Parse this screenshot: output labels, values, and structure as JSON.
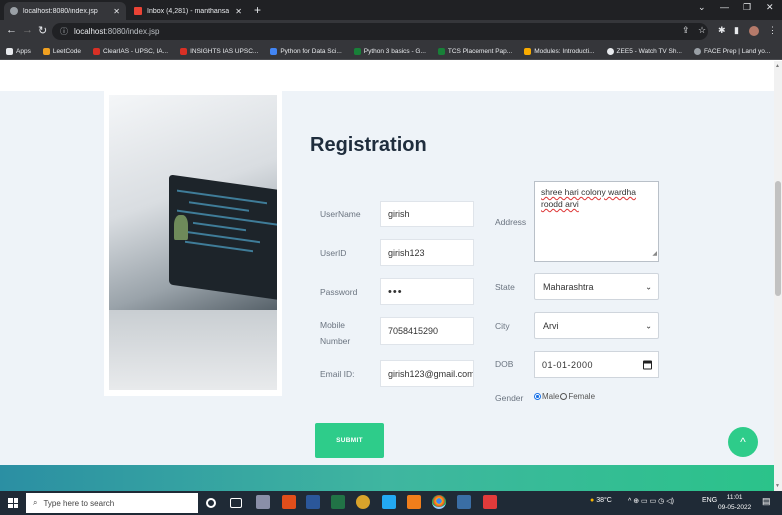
{
  "browser": {
    "tabs": [
      {
        "title": "localhost:8080/index.jsp",
        "favicon": "globe-icon",
        "active": true
      },
      {
        "title": "Inbox (4,281) - manthansapkal1...",
        "favicon": "gmail-icon",
        "active": false
      }
    ],
    "new_tab": "+",
    "address": {
      "host": "localhost",
      "rest": ":8080/index.jsp"
    },
    "bookmarks": [
      {
        "label": "Apps",
        "color": "#e8eaed"
      },
      {
        "label": "LeetCode",
        "color": "#f0a020"
      },
      {
        "label": "ClearIAS - UPSC, IA...",
        "color": "#d93025"
      },
      {
        "label": "INSIGHTS IAS UPSC...",
        "color": "#d93025"
      },
      {
        "label": "Python for Data Sci...",
        "color": "#4285f4"
      },
      {
        "label": "Python 3 basics - G...",
        "color": "#188038"
      },
      {
        "label": "TCS Placement Pap...",
        "color": "#188038"
      },
      {
        "label": "Modules: Introducti...",
        "color": "#f9ab00"
      },
      {
        "label": "ZEE5 - Watch TV Sh...",
        "color": "#e8eaed"
      },
      {
        "label": "FACE Prep | Land yo...",
        "color": "#9aa0a6"
      }
    ]
  },
  "form": {
    "title": "Registration",
    "username": {
      "label": "UserName",
      "value": "girish"
    },
    "userid": {
      "label": "UserID",
      "value": "girish123"
    },
    "password": {
      "label": "Password",
      "value": "•••"
    },
    "mobile": {
      "label_line1": "Mobile",
      "label_line2": "Number",
      "value": "7058415290"
    },
    "email": {
      "label": "Email ID:",
      "value": "girish123@gmail.com"
    },
    "address": {
      "label": "Address",
      "value": "shree hari colony wardha roodd arvi"
    },
    "state": {
      "label": "State",
      "value": "Maharashtra"
    },
    "city": {
      "label": "City",
      "value": "Arvi"
    },
    "dob": {
      "label": "DOB",
      "value": "01-01-2000"
    },
    "gender": {
      "label": "Gender",
      "options": [
        "Male",
        "Female"
      ],
      "selected": "Male"
    },
    "submit_label": "SUBMIT"
  },
  "back_to_top": "^",
  "taskbar": {
    "search_placeholder": "Type here to search",
    "weather": "38°C",
    "language": "ENG",
    "time": "11:01",
    "date": "09-05-2022"
  },
  "colors": {
    "accent_green": "#2ecc8a",
    "section_bg": "#eef3f8"
  }
}
